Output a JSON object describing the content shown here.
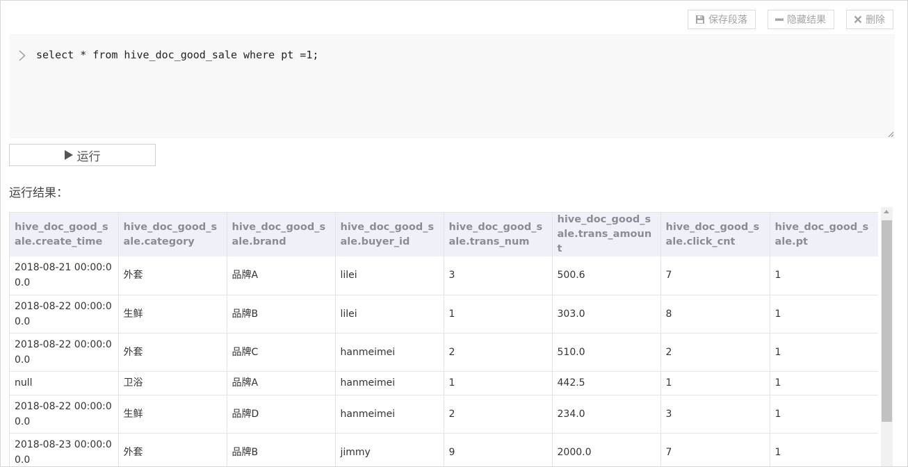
{
  "toolbar": {
    "save_label": "保存段落",
    "hide_label": "隐藏结果",
    "delete_label": "删除"
  },
  "editor": {
    "sql": "select * from hive_doc_good_sale where pt =1;"
  },
  "run": {
    "label": "运行"
  },
  "result": {
    "label": "运行结果："
  },
  "table": {
    "headers": [
      "hive_doc_good_sale.create_time",
      "hive_doc_good_sale.category",
      "hive_doc_good_sale.brand",
      "hive_doc_good_sale.buyer_id",
      "hive_doc_good_sale.trans_num",
      "hive_doc_good_sale.trans_amount",
      "hive_doc_good_sale.click_cnt",
      "hive_doc_good_sale.pt"
    ],
    "rows": [
      [
        "2018-08-21 00:00:00.0",
        "外套",
        "品牌A",
        "lilei",
        "3",
        "500.6",
        "7",
        "1"
      ],
      [
        "2018-08-22 00:00:00.0",
        "生鲜",
        "品牌B",
        "lilei",
        "1",
        "303.0",
        "8",
        "1"
      ],
      [
        "2018-08-22 00:00:00.0",
        "外套",
        "品牌C",
        "hanmeimei",
        "2",
        "510.0",
        "2",
        "1"
      ],
      [
        "null",
        "卫浴",
        "品牌A",
        "hanmeimei",
        "1",
        "442.5",
        "1",
        "1"
      ],
      [
        "2018-08-22 00:00:00.0",
        "生鲜",
        "品牌D",
        "hanmeimei",
        "2",
        "234.0",
        "3",
        "1"
      ],
      [
        "2018-08-23 00:00:00.0",
        "外套",
        "品牌B",
        "jimmy",
        "9",
        "2000.0",
        "7",
        "1"
      ]
    ]
  },
  "icons": {
    "save": "floppy-disk-icon",
    "hide": "minus-icon",
    "delete": "close-icon",
    "prompt": "chevron-right-icon",
    "run": "play-icon"
  },
  "colors": {
    "header_bg": "#eef1f7",
    "header_text": "#8a8d93",
    "editor_bg": "#f8f8f8",
    "button_text": "#a4a4a4"
  }
}
